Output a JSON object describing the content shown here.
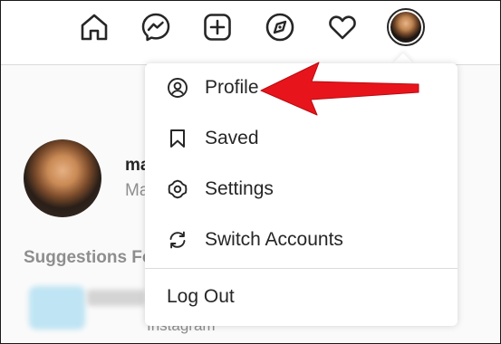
{
  "nav": {
    "icons": [
      "home-icon",
      "messenger-icon",
      "new-post-icon",
      "explore-icon",
      "activity-heart-icon",
      "profile-avatar"
    ]
  },
  "feed": {
    "user_name": "ma",
    "user_sub": "Ma",
    "suggestions_label": "Suggestions Fo",
    "suggestion_sub": "Instagram"
  },
  "menu": {
    "items": [
      {
        "label": "Profile",
        "icon": "profile-circle-icon"
      },
      {
        "label": "Saved",
        "icon": "bookmark-icon"
      },
      {
        "label": "Settings",
        "icon": "settings-gear-icon"
      },
      {
        "label": "Switch Accounts",
        "icon": "switch-accounts-icon"
      }
    ],
    "logout_label": "Log Out"
  },
  "colors": {
    "annotation_arrow": "#e8141c",
    "divider": "#dbdbdb",
    "text": "#262626",
    "muted": "#8e8e8e"
  }
}
